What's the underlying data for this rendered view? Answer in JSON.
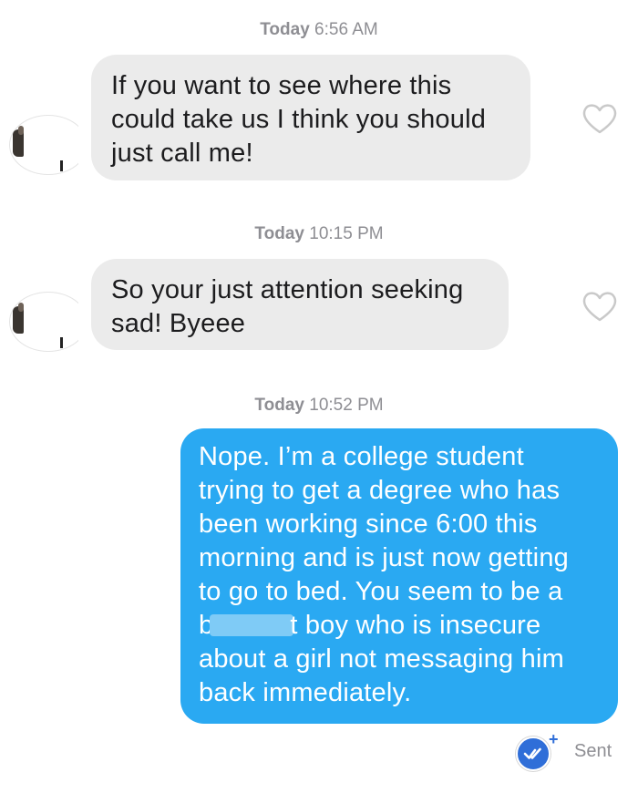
{
  "messages": [
    {
      "timestamp": {
        "day": "Today",
        "time": "6:56 AM"
      },
      "direction": "incoming",
      "lines": [
        "If you want to see where this",
        "could take us I think you should",
        "just call me!"
      ]
    },
    {
      "timestamp": {
        "day": "Today",
        "time": "10:15 PM"
      },
      "direction": "incoming",
      "lines": [
        "So your just attention seeking",
        "sad! Byeee"
      ]
    },
    {
      "timestamp": {
        "day": "Today",
        "time": "10:52 PM"
      },
      "direction": "outgoing",
      "lines": [
        "Nope. I’m a college student",
        "trying to get a degree who has",
        "been working since 6:00 this",
        "morning and is just now getting",
        "to go to bed. You seem to be a"
      ],
      "redacted_line": {
        "before": "b",
        "after": "t boy who is insecure"
      },
      "lines_after": [
        "about a girl not messaging him",
        "back immediately."
      ]
    }
  ],
  "status": {
    "label": "Sent",
    "plus": "+",
    "icon": "double-check-icon"
  },
  "colors": {
    "incoming_bubble": "#ebebeb",
    "outgoing_bubble": "#2aa9f2",
    "timestamp_text": "#8e8e93",
    "receipt_icon": "#2f6ed8"
  }
}
